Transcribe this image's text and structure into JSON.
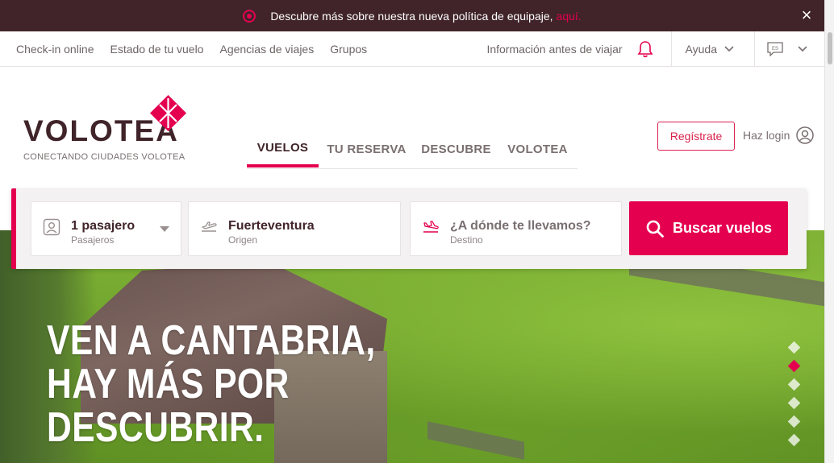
{
  "announcement": {
    "text": "Descubre más sobre nuestra nueva política de equipaje,",
    "link": "aquí."
  },
  "topnav": {
    "left_links": [
      "Check-in online",
      "Estado de tu vuelo",
      "Agencias de viajes",
      "Grupos"
    ],
    "info": "Información antes de viajar",
    "help": "Ayuda",
    "language_code": "ES"
  },
  "brand": {
    "name": "VOLOTEA",
    "tagline": "CONECTANDO CIUDADES VOLOTEA",
    "color_primary": "#e4004f",
    "color_dark": "#40242a"
  },
  "tabs": [
    {
      "label": "VUELOS",
      "active": true
    },
    {
      "label": "TU RESERVA",
      "active": false
    },
    {
      "label": "DESCUBRE",
      "active": false
    },
    {
      "label": "VOLOTEA",
      "active": false
    }
  ],
  "account": {
    "register": "Regístrate",
    "login": "Haz login"
  },
  "search": {
    "passengers": {
      "value": "1 pasajero",
      "label": "Pasajeros",
      "icon": "passenger-icon"
    },
    "origin": {
      "value": "Fuerteventura",
      "label": "Origen",
      "icon": "takeoff-icon"
    },
    "destination": {
      "value": "¿A dónde te llevamos?",
      "label": "Destino",
      "icon": "landing-icon"
    },
    "button": "Buscar vuelos"
  },
  "hero": {
    "line1": "VEN A CANTABRIA,",
    "line2": "HAY MÁS POR",
    "line3": "DESCUBRIR.",
    "slides_total": 6,
    "active_slide": 2
  }
}
